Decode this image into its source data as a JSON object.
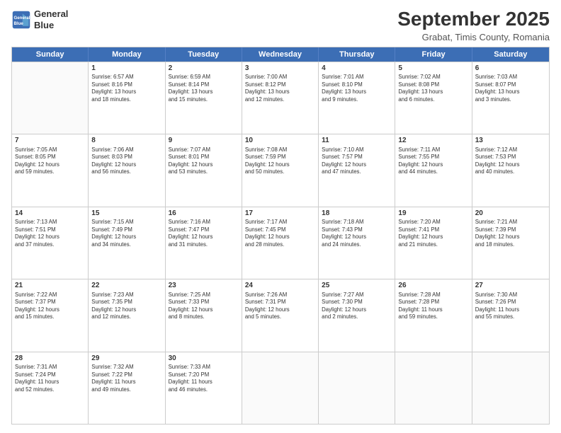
{
  "header": {
    "logo_line1": "General",
    "logo_line2": "Blue",
    "month": "September 2025",
    "location": "Grabat, Timis County, Romania"
  },
  "weekdays": [
    "Sunday",
    "Monday",
    "Tuesday",
    "Wednesday",
    "Thursday",
    "Friday",
    "Saturday"
  ],
  "rows": [
    [
      {
        "day": "",
        "lines": []
      },
      {
        "day": "1",
        "lines": [
          "Sunrise: 6:57 AM",
          "Sunset: 8:16 PM",
          "Daylight: 13 hours",
          "and 18 minutes."
        ]
      },
      {
        "day": "2",
        "lines": [
          "Sunrise: 6:59 AM",
          "Sunset: 8:14 PM",
          "Daylight: 13 hours",
          "and 15 minutes."
        ]
      },
      {
        "day": "3",
        "lines": [
          "Sunrise: 7:00 AM",
          "Sunset: 8:12 PM",
          "Daylight: 13 hours",
          "and 12 minutes."
        ]
      },
      {
        "day": "4",
        "lines": [
          "Sunrise: 7:01 AM",
          "Sunset: 8:10 PM",
          "Daylight: 13 hours",
          "and 9 minutes."
        ]
      },
      {
        "day": "5",
        "lines": [
          "Sunrise: 7:02 AM",
          "Sunset: 8:08 PM",
          "Daylight: 13 hours",
          "and 6 minutes."
        ]
      },
      {
        "day": "6",
        "lines": [
          "Sunrise: 7:03 AM",
          "Sunset: 8:07 PM",
          "Daylight: 13 hours",
          "and 3 minutes."
        ]
      }
    ],
    [
      {
        "day": "7",
        "lines": [
          "Sunrise: 7:05 AM",
          "Sunset: 8:05 PM",
          "Daylight: 12 hours",
          "and 59 minutes."
        ]
      },
      {
        "day": "8",
        "lines": [
          "Sunrise: 7:06 AM",
          "Sunset: 8:03 PM",
          "Daylight: 12 hours",
          "and 56 minutes."
        ]
      },
      {
        "day": "9",
        "lines": [
          "Sunrise: 7:07 AM",
          "Sunset: 8:01 PM",
          "Daylight: 12 hours",
          "and 53 minutes."
        ]
      },
      {
        "day": "10",
        "lines": [
          "Sunrise: 7:08 AM",
          "Sunset: 7:59 PM",
          "Daylight: 12 hours",
          "and 50 minutes."
        ]
      },
      {
        "day": "11",
        "lines": [
          "Sunrise: 7:10 AM",
          "Sunset: 7:57 PM",
          "Daylight: 12 hours",
          "and 47 minutes."
        ]
      },
      {
        "day": "12",
        "lines": [
          "Sunrise: 7:11 AM",
          "Sunset: 7:55 PM",
          "Daylight: 12 hours",
          "and 44 minutes."
        ]
      },
      {
        "day": "13",
        "lines": [
          "Sunrise: 7:12 AM",
          "Sunset: 7:53 PM",
          "Daylight: 12 hours",
          "and 40 minutes."
        ]
      }
    ],
    [
      {
        "day": "14",
        "lines": [
          "Sunrise: 7:13 AM",
          "Sunset: 7:51 PM",
          "Daylight: 12 hours",
          "and 37 minutes."
        ]
      },
      {
        "day": "15",
        "lines": [
          "Sunrise: 7:15 AM",
          "Sunset: 7:49 PM",
          "Daylight: 12 hours",
          "and 34 minutes."
        ]
      },
      {
        "day": "16",
        "lines": [
          "Sunrise: 7:16 AM",
          "Sunset: 7:47 PM",
          "Daylight: 12 hours",
          "and 31 minutes."
        ]
      },
      {
        "day": "17",
        "lines": [
          "Sunrise: 7:17 AM",
          "Sunset: 7:45 PM",
          "Daylight: 12 hours",
          "and 28 minutes."
        ]
      },
      {
        "day": "18",
        "lines": [
          "Sunrise: 7:18 AM",
          "Sunset: 7:43 PM",
          "Daylight: 12 hours",
          "and 24 minutes."
        ]
      },
      {
        "day": "19",
        "lines": [
          "Sunrise: 7:20 AM",
          "Sunset: 7:41 PM",
          "Daylight: 12 hours",
          "and 21 minutes."
        ]
      },
      {
        "day": "20",
        "lines": [
          "Sunrise: 7:21 AM",
          "Sunset: 7:39 PM",
          "Daylight: 12 hours",
          "and 18 minutes."
        ]
      }
    ],
    [
      {
        "day": "21",
        "lines": [
          "Sunrise: 7:22 AM",
          "Sunset: 7:37 PM",
          "Daylight: 12 hours",
          "and 15 minutes."
        ]
      },
      {
        "day": "22",
        "lines": [
          "Sunrise: 7:23 AM",
          "Sunset: 7:35 PM",
          "Daylight: 12 hours",
          "and 12 minutes."
        ]
      },
      {
        "day": "23",
        "lines": [
          "Sunrise: 7:25 AM",
          "Sunset: 7:33 PM",
          "Daylight: 12 hours",
          "and 8 minutes."
        ]
      },
      {
        "day": "24",
        "lines": [
          "Sunrise: 7:26 AM",
          "Sunset: 7:31 PM",
          "Daylight: 12 hours",
          "and 5 minutes."
        ]
      },
      {
        "day": "25",
        "lines": [
          "Sunrise: 7:27 AM",
          "Sunset: 7:30 PM",
          "Daylight: 12 hours",
          "and 2 minutes."
        ]
      },
      {
        "day": "26",
        "lines": [
          "Sunrise: 7:28 AM",
          "Sunset: 7:28 PM",
          "Daylight: 11 hours",
          "and 59 minutes."
        ]
      },
      {
        "day": "27",
        "lines": [
          "Sunrise: 7:30 AM",
          "Sunset: 7:26 PM",
          "Daylight: 11 hours",
          "and 55 minutes."
        ]
      }
    ],
    [
      {
        "day": "28",
        "lines": [
          "Sunrise: 7:31 AM",
          "Sunset: 7:24 PM",
          "Daylight: 11 hours",
          "and 52 minutes."
        ]
      },
      {
        "day": "29",
        "lines": [
          "Sunrise: 7:32 AM",
          "Sunset: 7:22 PM",
          "Daylight: 11 hours",
          "and 49 minutes."
        ]
      },
      {
        "day": "30",
        "lines": [
          "Sunrise: 7:33 AM",
          "Sunset: 7:20 PM",
          "Daylight: 11 hours",
          "and 46 minutes."
        ]
      },
      {
        "day": "",
        "lines": []
      },
      {
        "day": "",
        "lines": []
      },
      {
        "day": "",
        "lines": []
      },
      {
        "day": "",
        "lines": []
      }
    ]
  ]
}
